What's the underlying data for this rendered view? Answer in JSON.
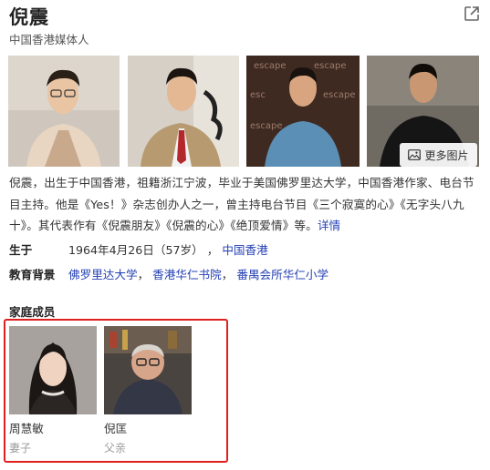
{
  "header": {
    "title": "倪震",
    "subtitle": "中国香港媒体人"
  },
  "photos": {
    "more_label": "更多图片"
  },
  "description": {
    "text": "倪震，出生于中国香港，祖籍浙江宁波，毕业于美国佛罗里达大学，中国香港作家、电台节目主持。他是《Yes！》杂志创办人之一，曾主持电台节目《三个寂寞的心》《无字头八九十》。其代表作有《倪震朋友》《倪震的心》《绝顶爱情》等。",
    "link": "详情"
  },
  "birth": {
    "label": "生于",
    "date": "1964年4月26日",
    "age": "（57岁）",
    "sep": "，",
    "place": "中国香港"
  },
  "education": {
    "label": "教育背景",
    "items": [
      "佛罗里达大学",
      "香港华仁书院",
      "番禺会所华仁小学"
    ],
    "sep": "，"
  },
  "family": {
    "title": "家庭成员",
    "members": [
      {
        "name": "周慧敏",
        "role": "妻子"
      },
      {
        "name": "倪匡",
        "role": "父亲"
      }
    ]
  },
  "colors": {
    "link": "#2440b3",
    "highlight_box": "#e02020"
  }
}
